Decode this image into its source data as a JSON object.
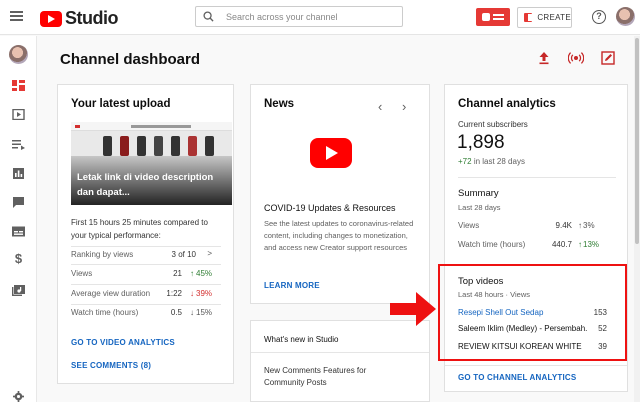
{
  "header": {
    "logo_text": "Studio",
    "search_placeholder": "Search across your channel",
    "create_label": "CREATE",
    "help_glyph": "?"
  },
  "page": {
    "title": "Channel dashboard"
  },
  "latest_upload": {
    "heading": "Your latest upload",
    "video_title": "Letak link di video description dan dapat...",
    "performance_text": "First 15 hours 25 minutes compared to your typical performance:",
    "rows": [
      {
        "label": "Ranking by views",
        "value": "3 of 10",
        "arrow": ">"
      },
      {
        "label": "Views",
        "value": "21",
        "arrow": "↑",
        "delta": "45%",
        "trend": "up"
      },
      {
        "label": "Average view duration",
        "value": "1:22",
        "arrow": "↓",
        "delta": "39%",
        "trend": "down"
      },
      {
        "label": "Watch time (hours)",
        "value": "0.5",
        "arrow": "↓",
        "delta": "15%",
        "trend": "neutral"
      }
    ],
    "analytics_link": "GO TO VIDEO ANALYTICS",
    "comments_link": "SEE COMMENTS (8)"
  },
  "news": {
    "heading": "News",
    "prev_glyph": "‹",
    "next_glyph": "›",
    "title": "COVID-19 Updates & Resources",
    "body": "See the latest updates to coronavirus-related content, including changes to monetization, and access new Creator support resources",
    "link": "LEARN MORE"
  },
  "whats_new": {
    "heading": "What's new in Studio",
    "item": "New Comments Features for Community Posts"
  },
  "analytics": {
    "heading": "Channel analytics",
    "subs_label": "Current subscribers",
    "subs_value": "1,898",
    "subs_change_prefix": "+72",
    "subs_change_suffix": "in last 28 days",
    "summary_heading": "Summary",
    "summary_period": "Last 28 days",
    "summary_rows": [
      {
        "label": "Views",
        "value": "9.4K",
        "arrow": "↑",
        "delta": "3%",
        "trend": "neutral"
      },
      {
        "label": "Watch time (hours)",
        "value": "440.7",
        "arrow": "↑",
        "delta": "13%",
        "trend": "up"
      }
    ],
    "top_heading": "Top videos",
    "top_period": "Last 48 hours · Views",
    "top_videos": [
      {
        "title": "Resepi Shell Out Sedap",
        "views": "153"
      },
      {
        "title": "Saleem Iklim (Medley) - Persembah...",
        "views": "52"
      },
      {
        "title": "REVIEW KITSUI KOREAN WHITE",
        "views": "39"
      }
    ],
    "link": "GO TO CHANNEL ANALYTICS"
  },
  "colors": {
    "brand_red": "#ff0000",
    "link_blue": "#1565c0",
    "positive_green": "#2e7d32",
    "negative_red": "#d32f2f",
    "highlight_red": "#ee1111"
  }
}
